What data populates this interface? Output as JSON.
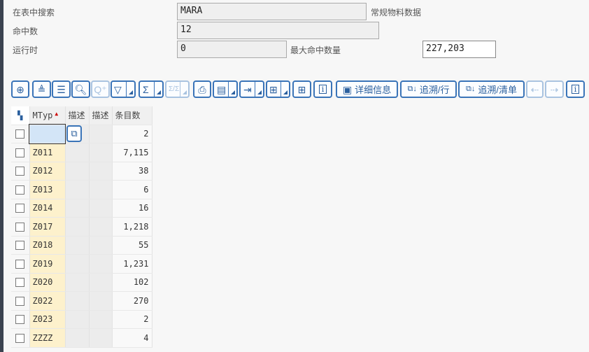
{
  "form": {
    "search_label": "在表中搜索",
    "search_value": "MARA",
    "search_desc": "常规物料数据",
    "hits_label": "命中数",
    "hits_value": "12",
    "runtime_label": "运行时",
    "runtime_value": "0",
    "max_hits_label": "最大命中数量",
    "max_hits_value": "227,203"
  },
  "toolbar": {
    "details": "详细信息",
    "trace_row": "追溯/行",
    "trace_list": "追溯/清单"
  },
  "table": {
    "headers": [
      "MTyp",
      "描述",
      "描述",
      "条目数"
    ],
    "rows": [
      {
        "mtyp": "",
        "count": "2"
      },
      {
        "mtyp": "Z011",
        "count": "7,115"
      },
      {
        "mtyp": "Z012",
        "count": "38"
      },
      {
        "mtyp": "Z013",
        "count": "6"
      },
      {
        "mtyp": "Z014",
        "count": "16"
      },
      {
        "mtyp": "Z017",
        "count": "1,218"
      },
      {
        "mtyp": "Z018",
        "count": "55"
      },
      {
        "mtyp": "Z019",
        "count": "1,231"
      },
      {
        "mtyp": "Z020",
        "count": "102"
      },
      {
        "mtyp": "Z022",
        "count": "270"
      },
      {
        "mtyp": "Z023",
        "count": "2"
      },
      {
        "mtyp": "ZZZZ",
        "count": "4"
      }
    ]
  }
}
